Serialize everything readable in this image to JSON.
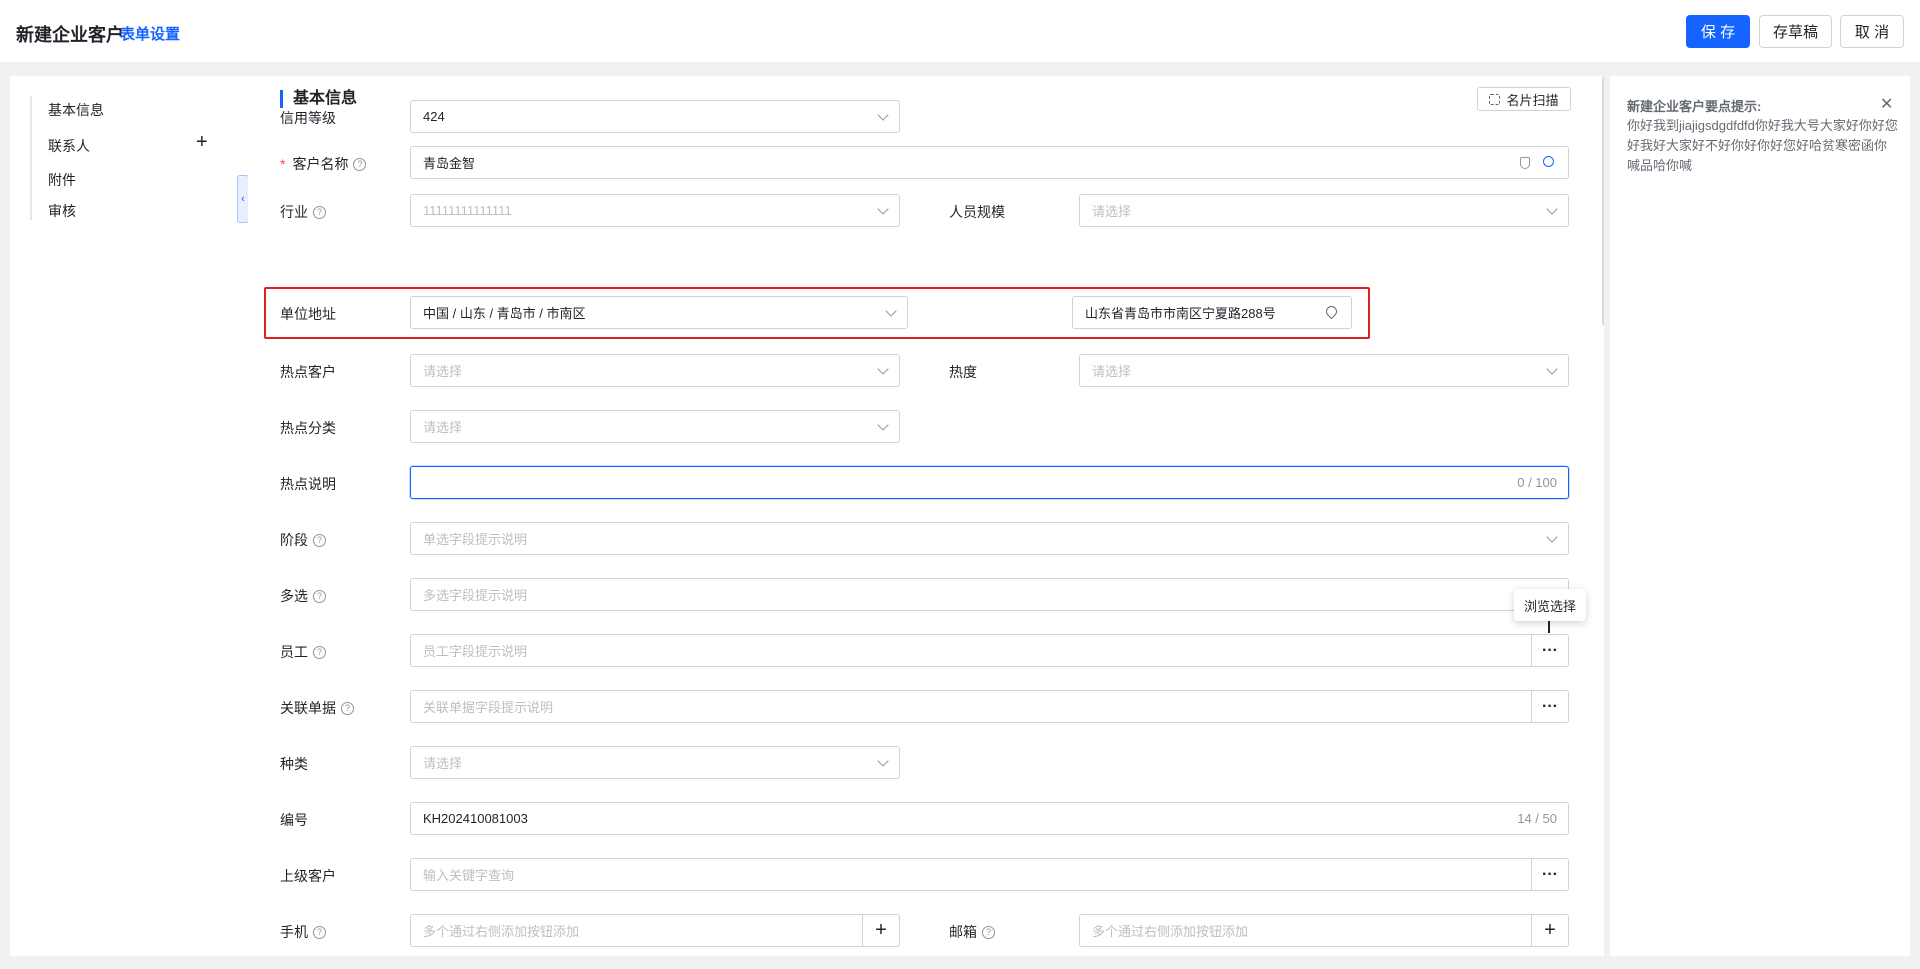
{
  "header": {
    "title": "新建企业客户",
    "form_settings": "表单设置",
    "save": "保 存",
    "draft": "存草稿",
    "cancel": "取 消"
  },
  "leftnav": {
    "items": [
      "基本信息",
      "联系人",
      "附件",
      "审核"
    ],
    "add_icon": "plus-icon"
  },
  "section": {
    "title": "基本信息",
    "scan_button": "名片扫描"
  },
  "fields": {
    "credit_level": {
      "label": "信用等级",
      "value": "424"
    },
    "customer_name": {
      "label": "客户名称",
      "value": "青岛金智"
    },
    "industry": {
      "label": "行业",
      "value": "11111111111111"
    },
    "staff_size": {
      "label": "人员规模",
      "placeholder": "请选择"
    },
    "address": {
      "label": "单位地址",
      "region": "中国 / 山东 / 青岛市 / 市南区",
      "detail": "山东省青岛市市南区宁夏路288号"
    },
    "hot_customer": {
      "label": "热点客户",
      "placeholder": "请选择"
    },
    "heat": {
      "label": "热度",
      "placeholder": "请选择"
    },
    "hot_category": {
      "label": "热点分类",
      "placeholder": "请选择"
    },
    "hot_desc": {
      "label": "热点说明",
      "counter": "0 / 100"
    },
    "stage": {
      "label": "阶段",
      "placeholder": "单选字段提示说明"
    },
    "multi": {
      "label": "多选",
      "placeholder": "多选字段提示说明"
    },
    "employee": {
      "label": "员工",
      "placeholder": "员工字段提示说明"
    },
    "related_doc": {
      "label": "关联单据",
      "placeholder": "关联单据字段提示说明"
    },
    "kind": {
      "label": "种类",
      "placeholder": "请选择"
    },
    "code": {
      "label": "编号",
      "value": "KH202410081003",
      "counter": "14 / 50"
    },
    "parent_customer": {
      "label": "上级客户",
      "placeholder": "输入关键字查询"
    },
    "mobile": {
      "label": "手机",
      "placeholder": "多个通过右侧添加按钮添加"
    },
    "email": {
      "label": "邮箱",
      "placeholder": "多个通过右侧添加按钮添加"
    }
  },
  "tooltip": {
    "text": "浏览选择"
  },
  "tips": {
    "title": "新建企业客户要点提示:",
    "body": "你好我到jiajigsdgdfdfd你好我大号大家好你好您好我好大家好不好你好你好您好哈贫寒密函你喊品哈你喊"
  },
  "colors": {
    "accent": "#1664ff",
    "highlight": "#e02020"
  }
}
